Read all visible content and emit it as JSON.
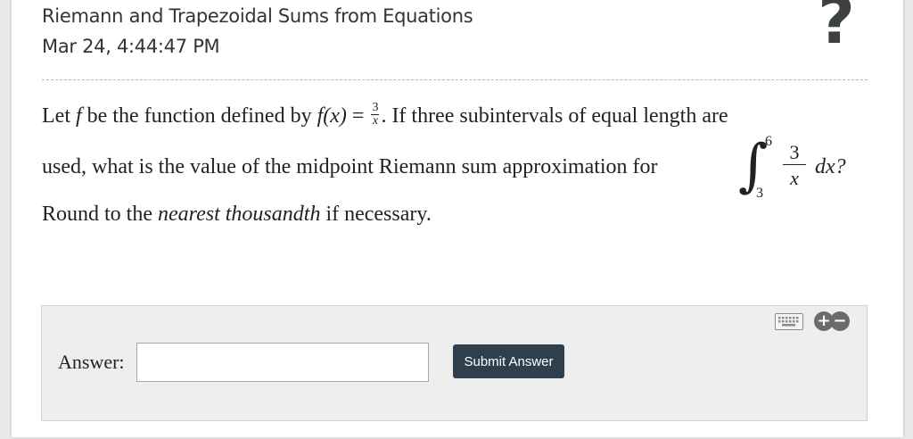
{
  "header": {
    "title": "Riemann and Trapezoidal Sums from Equations",
    "date": "Mar 24, 4:44:47 PM",
    "help_symbol": "?"
  },
  "question": {
    "t1": "Let ",
    "f1": "f",
    "t2": " be the function defined by ",
    "f2": "f",
    "paren_x": "(x)",
    "eq": " = ",
    "frac_num": "3",
    "frac_den": "x",
    "t3": ". If three subintervals of equal length are",
    "line2": "used, what is the value of the midpoint Riemann sum approximation for",
    "integral": {
      "upper": "6",
      "lower": "3",
      "num": "3",
      "den": "x",
      "dx": "dx?"
    },
    "line3_pre": "Round to the ",
    "line3_em": "nearest thousandth",
    "line3_post": " if necessary."
  },
  "answer": {
    "label": "Answer:",
    "value": "",
    "submit_label": "Submit Answer",
    "plus_symbol": "+",
    "minus_symbol": "−"
  }
}
